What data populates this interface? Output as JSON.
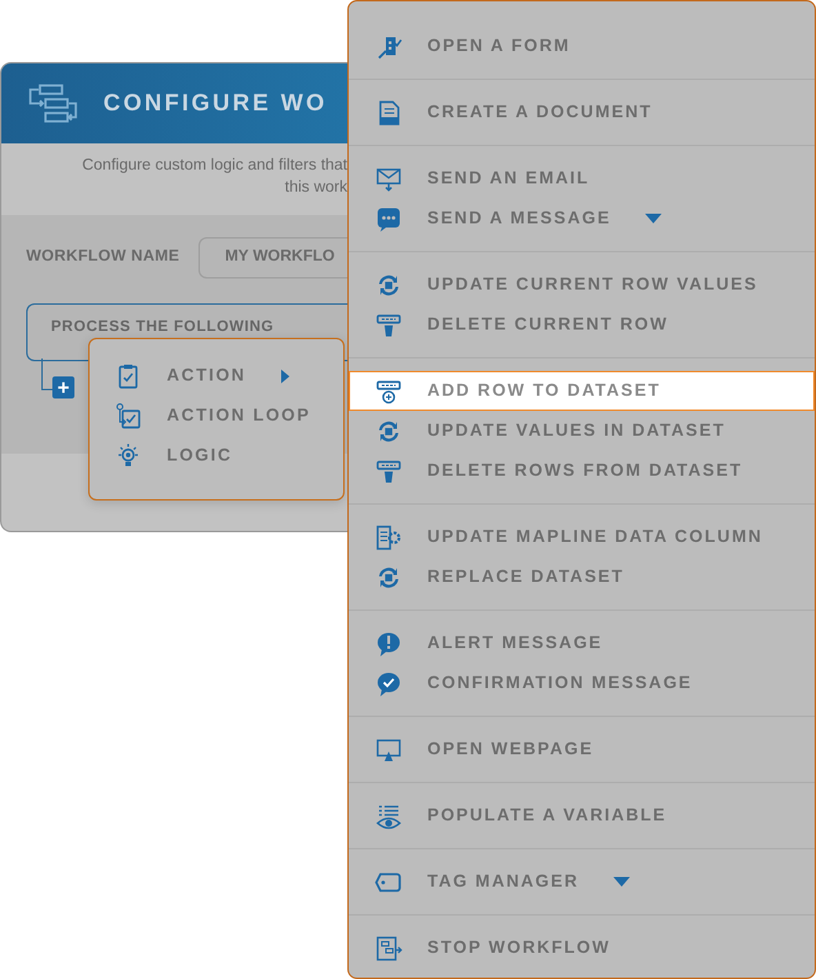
{
  "panel": {
    "title": "CONFIGURE WO",
    "description": [
      "Configure custom logic and filters that",
      "this work"
    ],
    "name_label": "WORKFLOW NAME",
    "name_value": "MY WORKFLO",
    "process_label": "PROCESS THE FOLLOWING",
    "add_button": "+"
  },
  "popup": {
    "items": [
      {
        "label": "ACTION",
        "submenu": true
      },
      {
        "label": "ACTION LOOP",
        "submenu": false
      },
      {
        "label": "LOGIC",
        "submenu": false
      }
    ]
  },
  "menu": {
    "sections": [
      {
        "items": [
          {
            "label": "OPEN A FORM",
            "selected": false,
            "dropdown": false
          }
        ]
      },
      {
        "items": [
          {
            "label": "CREATE A DOCUMENT",
            "selected": false,
            "dropdown": false
          }
        ]
      },
      {
        "items": [
          {
            "label": "SEND AN EMAIL",
            "selected": false,
            "dropdown": false
          },
          {
            "label": "SEND A MESSAGE",
            "selected": false,
            "dropdown": true
          }
        ]
      },
      {
        "items": [
          {
            "label": "UPDATE CURRENT ROW VALUES",
            "selected": false,
            "dropdown": false
          },
          {
            "label": "DELETE CURRENT ROW",
            "selected": false,
            "dropdown": false
          }
        ]
      },
      {
        "items": [
          {
            "label": "ADD ROW TO DATASET",
            "selected": true,
            "dropdown": false
          },
          {
            "label": "UPDATE VALUES IN DATASET",
            "selected": false,
            "dropdown": false
          },
          {
            "label": "DELETE ROWS FROM DATASET",
            "selected": false,
            "dropdown": false
          }
        ]
      },
      {
        "items": [
          {
            "label": "UPDATE MAPLINE DATA COLUMN",
            "selected": false,
            "dropdown": false
          },
          {
            "label": "REPLACE DATASET",
            "selected": false,
            "dropdown": false
          }
        ]
      },
      {
        "items": [
          {
            "label": "ALERT MESSAGE",
            "selected": false,
            "dropdown": false
          },
          {
            "label": "CONFIRMATION MESSAGE",
            "selected": false,
            "dropdown": false
          }
        ]
      },
      {
        "items": [
          {
            "label": "OPEN WEBPAGE",
            "selected": false,
            "dropdown": false
          }
        ]
      },
      {
        "items": [
          {
            "label": "POPULATE A VARIABLE",
            "selected": false,
            "dropdown": false
          }
        ]
      },
      {
        "items": [
          {
            "label": "TAG MANAGER",
            "selected": false,
            "dropdown": true
          }
        ]
      },
      {
        "items": [
          {
            "label": "STOP WORKFLOW",
            "selected": false,
            "dropdown": false
          }
        ]
      }
    ]
  }
}
